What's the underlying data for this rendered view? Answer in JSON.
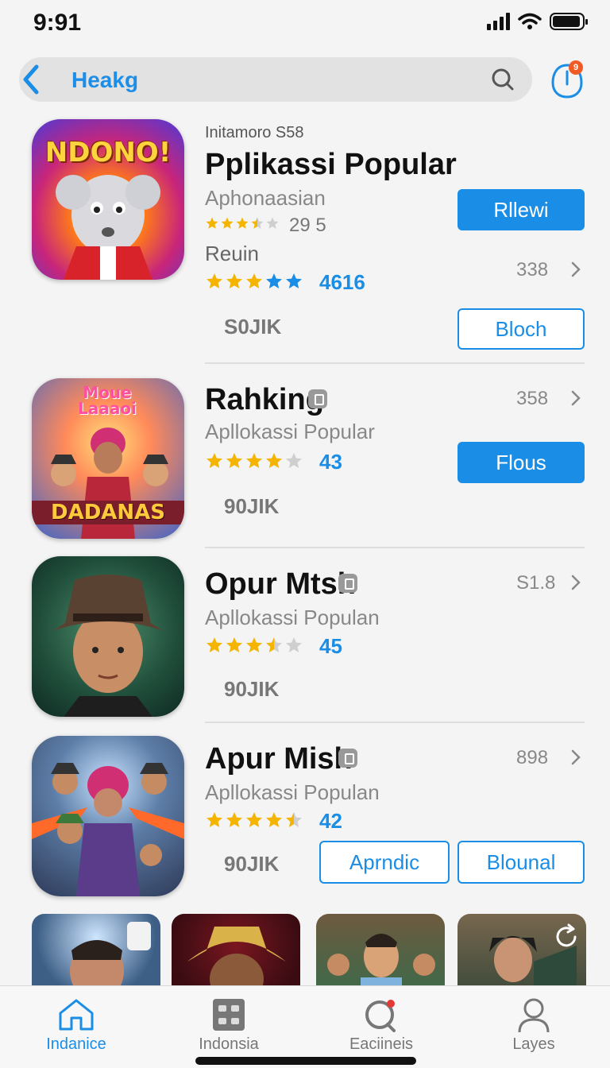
{
  "status": {
    "time": "9:91"
  },
  "search": {
    "text": "Heakg"
  },
  "notification": {
    "badge": "9"
  },
  "apps": [
    {
      "overline": "Initamoro S58",
      "title": "Pplikassi  Popular",
      "subtitle": "Aphonaasian",
      "rating_count": "29 5",
      "meta": "Reuin",
      "rating_value": "4616",
      "count": "338",
      "size": "S0JIK",
      "buttons": [
        "Rllewi",
        "Bloch"
      ],
      "icon_title": "NDONO!",
      "stars_a": 3.5,
      "stars_b": 5
    },
    {
      "title": "Rahking",
      "subtitle": "Apllokassi Popular",
      "rating_value": "43",
      "count": "358",
      "size": "90JIK",
      "buttons": [
        "Flous"
      ],
      "icon_title": "Moue Laaaoi",
      "icon_sub": "DADANAS",
      "stars": 4
    },
    {
      "title": "Opur Mtsh",
      "subtitle": "Apllokassi Populan",
      "rating_value": "45",
      "count": "S1.8",
      "size": "90JIK",
      "stars": 3.5
    },
    {
      "title": "Apur Mish",
      "subtitle": "Apllokassi Populan",
      "rating_value": "42",
      "count": "898",
      "size": "90JIK",
      "buttons": [
        "Aprndic",
        "Blounal"
      ],
      "stars": 4.5
    }
  ],
  "tabs": [
    {
      "label": "Indanice",
      "icon": "home-icon",
      "active": true
    },
    {
      "label": "Indonsia",
      "icon": "grid-icon",
      "active": false
    },
    {
      "label": "Eaciineis",
      "icon": "search-icon",
      "active": false
    },
    {
      "label": "Layes",
      "icon": "person-icon",
      "active": false
    }
  ],
  "colors": {
    "accent": "#1a8de6",
    "star": "#f5b400",
    "star_blue": "#1a8de6"
  }
}
